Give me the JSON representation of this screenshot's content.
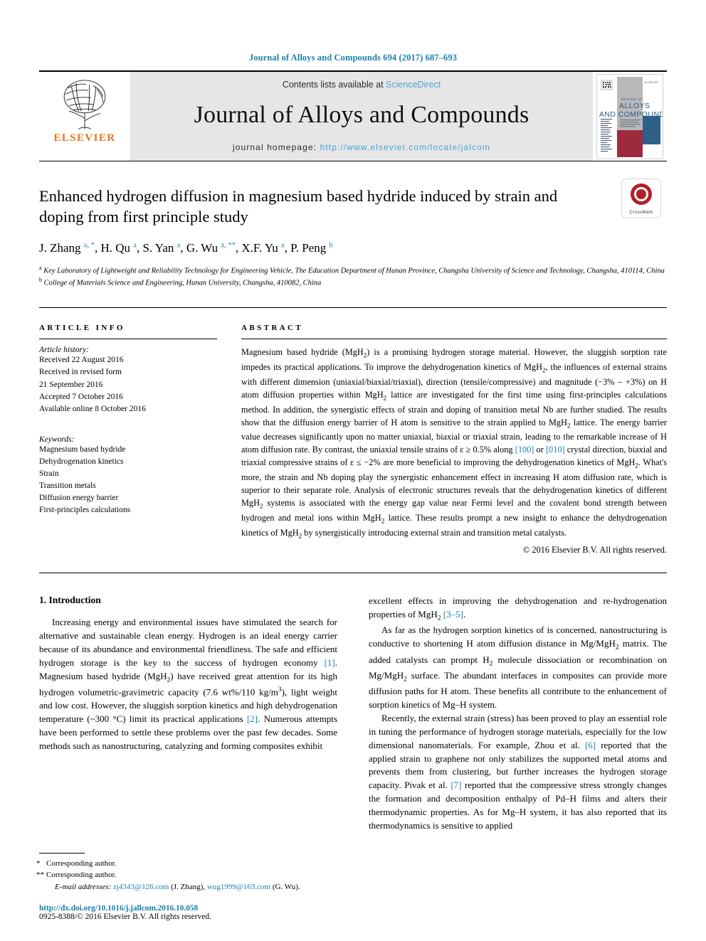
{
  "running_head": "Journal of Alloys and Compounds 694 (2017) 687–693",
  "masthead": {
    "publisher": "ELSEVIER",
    "contents_prefix": "Contents lists available at ",
    "contents_link": "ScienceDirect",
    "journal_name": "Journal of Alloys and Compounds",
    "homepage_prefix": "journal homepage: ",
    "homepage_url": "http://www.elsevier.com/locate/jalcom",
    "cover": {
      "line1": "Journal of",
      "line2": "ALLOYS",
      "line3": "AND COMPOUNDS"
    }
  },
  "article": {
    "title": "Enhanced hydrogen diffusion in magnesium based hydride induced by strain and doping from first principle study",
    "crossmark_label": "CrossMark",
    "authors": [
      {
        "name": "J. Zhang",
        "marks": "a, *"
      },
      {
        "name": "H. Qu",
        "marks": "a"
      },
      {
        "name": "S. Yan",
        "marks": "a"
      },
      {
        "name": "G. Wu",
        "marks": "a, **"
      },
      {
        "name": "X.F. Yu",
        "marks": "a"
      },
      {
        "name": "P. Peng",
        "marks": "b"
      }
    ],
    "affiliations": [
      {
        "mark": "a",
        "text": "Key Laboratory of Lightweight and Reliability Technology for Engineering Vehicle, The Education Department of Hunan Province, Changsha University of Science and Technology, Changsha, 410114, China"
      },
      {
        "mark": "b",
        "text": "College of Materials Science and Engineering, Hunan University, Changsha, 410082, China"
      }
    ]
  },
  "article_info": {
    "heading": "ARTICLE INFO",
    "history_label": "Article history:",
    "history": [
      "Received 22 August 2016",
      "Received in revised form",
      "21 September 2016",
      "Accepted 7 October 2016",
      "Available online 8 October 2016"
    ],
    "keywords_label": "Keywords:",
    "keywords": [
      "Magnesium based hydride",
      "Dehydrogenation kinetics",
      "Strain",
      "Transition metals",
      "Diffusion energy barrier",
      "First-principles calculations"
    ]
  },
  "abstract": {
    "heading": "ABSTRACT",
    "text": "Magnesium based hydride (MgH2) is a promising hydrogen storage material. However, the sluggish sorption rate impedes its practical applications. To improve the dehydrogenation kinetics of MgH2, the influences of external strains with different dimension (uniaxial/biaxial/triaxial), direction (tensile/compressive) and magnitude (−3% – +3%) on H atom diffusion properties within MgH2 lattice are investigated for the first time using first-principles calculations method. In addition, the synergistic effects of strain and doping of transition metal Nb are further studied. The results show that the diffusion energy barrier of H atom is sensitive to the strain applied to MgH2 lattice. The energy barrier value decreases significantly upon no matter uniaxial, biaxial or triaxial strain, leading to the remarkable increase of H atom diffusion rate. By contrast, the uniaxial tensile strains of ε ≥ 0.5% along [100] or [010] crystal direction, biaxial and triaxial compressive strains of ε ≤ −2% are more beneficial to improving the dehydrogenation kinetics of MgH2. What's more, the strain and Nb doping play the synergistic enhancement effect in increasing H atom diffusion rate, which is superior to their separate role. Analysis of electronic structures reveals that the dehydrogenation kinetics of different MgH2 systems is associated with the energy gap value near Fermi level and the covalent bond strength between hydrogen and metal ions within MgH2 lattice. These results prompt a new insight to enhance the dehydrogenation kinetics of MgH2 by synergistically introducing external strain and transition metal catalysts.",
    "copyright": "© 2016 Elsevier B.V. All rights reserved."
  },
  "body": {
    "section_number_title": "1. Introduction",
    "left_paragraphs": [
      "Increasing energy and environmental issues have stimulated the search for alternative and sustainable clean energy. Hydrogen is an ideal energy carrier because of its abundance and environmental friendliness. The safe and efficient hydrogen storage is the key to the success of hydrogen economy [1]. Magnesium based hydride (MgH2) have received great attention for its high hydrogen volumetric-gravimetric capacity (7.6 wt%/110 kg/m3), light weight and low cost. However, the sluggish sorption kinetics and high dehydrogenation temperature (~300 °C) limit its practical applications [2]. Numerous attempts have been performed to settle these problems over the past few decades. Some methods such as nanostructuring, catalyzing and forming composites exhibit"
    ],
    "right_paragraphs": [
      "excellent effects in improving the dehydrogenation and re-hydrogenation properties of MgH2 [3–5].",
      "As far as the hydrogen sorption kinetics of is concerned, nanostructuring is conductive to shortening H atom diffusion distance in Mg/MgH2 matrix. The added catalysts can prompt H2 molecule dissociation or recombination on Mg/MgH2 surface. The abundant interfaces in composites can provide more diffusion paths for H atom. These benefits all contribute to the enhancement of sorption kinetics of Mg–H system.",
      "Recently, the external strain (stress) has been proved to play an essential role in tuning the performance of hydrogen storage materials, especially for the low dimensional nanomaterials. For example, Zhou et al. [6] reported that the applied strain to graphene not only stabilizes the supported metal atoms and prevents them from clustering, but further increases the hydrogen storage capacity. Pivak et al. [7] reported that the compressive stress strongly changes the formation and decomposition enthalpy of Pd–H films and alters their thermodynamic properties. As for Mg–H system, it has also reported that its thermodynamics is sensitive to applied"
    ]
  },
  "footnotes": {
    "corresponding1_mark": "*",
    "corresponding1": "Corresponding author.",
    "corresponding2_mark": "**",
    "corresponding2": "Corresponding author.",
    "emails_label": "E-mail addresses:",
    "email1": "zj4343@126.com",
    "email1_owner": "(J. Zhang)",
    "email2": "wug1999@163.com",
    "email2_owner": "(G. Wu).",
    "doi": "http://dx.doi.org/10.1016/j.jallcom.2016.10.058",
    "issn": "0925-8388/© 2016 Elsevier B.V. All rights reserved."
  },
  "colors": {
    "link_blue": "#1a7fad",
    "light_blue": "#4ea3d4",
    "elsevier_orange": "#e8721c",
    "masthead_gray": "#e6e6e6",
    "crossmark_red": "#b12028"
  }
}
